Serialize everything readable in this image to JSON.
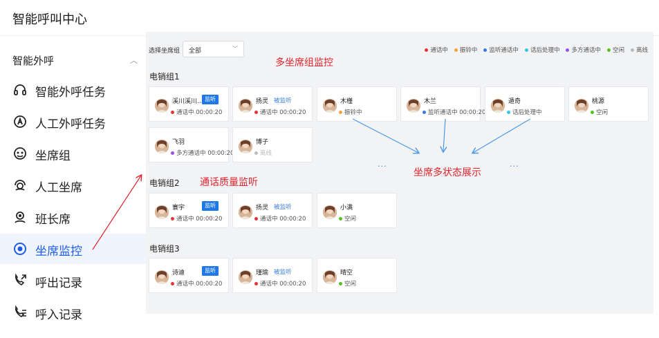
{
  "app": {
    "title": "智能呼叫中心"
  },
  "sidebar": {
    "group_label": "智能外呼",
    "items": [
      {
        "label": "智能外呼任务",
        "icon": "headset-task-icon"
      },
      {
        "label": "人工外呼任务",
        "icon": "hand-task-icon"
      },
      {
        "label": "坐席组",
        "icon": "agent-group-icon"
      },
      {
        "label": "人工坐席",
        "icon": "agent-icon"
      },
      {
        "label": "班长席",
        "icon": "supervisor-icon"
      },
      {
        "label": "坐席监控",
        "icon": "monitor-icon"
      },
      {
        "label": "呼出记录",
        "icon": "outbound-call-icon"
      },
      {
        "label": "呼入记录",
        "icon": "inbound-call-icon"
      }
    ],
    "active_index": 5
  },
  "filter": {
    "label": "选择坐席组",
    "value": "全部"
  },
  "legend": [
    {
      "label": "通话中",
      "color": "#e8333a"
    },
    {
      "label": "振铃中",
      "color": "#f2a33a"
    },
    {
      "label": "监听通话中",
      "color": "#3a78e0"
    },
    {
      "label": "话后处理中",
      "color": "#33c7e0"
    },
    {
      "label": "多方通话中",
      "color": "#9b4fdc"
    },
    {
      "label": "空闲",
      "color": "#52c41a"
    },
    {
      "label": "离线",
      "color": "#bbbbbb"
    }
  ],
  "groups": [
    {
      "title": "电销组1",
      "agents": [
        {
          "name": "溪川溪川...",
          "status": "通话中 00:00:20",
          "color": "#e8333a",
          "monitor": "监听"
        },
        {
          "name": "扬灵",
          "status": "通话中 00:00:20",
          "color": "#e8333a",
          "monitored": "被监听"
        },
        {
          "name": "木槿",
          "status": "振铃中",
          "color": "#f2a33a"
        },
        {
          "name": "木兰",
          "status": "监听通话中 00:00:20",
          "color": "#3a78e0"
        },
        {
          "name": "遁奇",
          "status": "话后处理中",
          "color": "#33c7e0"
        },
        {
          "name": "桃源",
          "status": "空闲",
          "color": "#52c41a"
        },
        {
          "name": "飞羽",
          "status": "多方通话中 00:00:20",
          "color": "#9b4fdc"
        },
        {
          "name": "博子",
          "status": "离线",
          "color": "#bbbbbb"
        }
      ]
    },
    {
      "title": "电销组2",
      "agents": [
        {
          "name": "寰宇",
          "status": "通话中 00:00:20",
          "color": "#e8333a",
          "monitor": "监听"
        },
        {
          "name": "扬灵",
          "status": "通话中 00:00:20",
          "color": "#e8333a",
          "monitored": "被监听"
        },
        {
          "name": "小满",
          "status": "空闲",
          "color": "#52c41a"
        }
      ]
    },
    {
      "title": "电销组3",
      "agents": [
        {
          "name": "诗迪",
          "status": "通话中 00:00:20",
          "color": "#e8333a",
          "monitor": "监听"
        },
        {
          "name": "瑾瑜",
          "status": "通话中 00:00:20",
          "color": "#e8333a",
          "monitored": "被监听"
        },
        {
          "name": "晴空",
          "status": "空闲",
          "color": "#52c41a"
        }
      ]
    }
  ],
  "annotations": {
    "multi_group": "多坐席组监控",
    "quality": "通话质量监听",
    "multi_status": "坐席多状态展示",
    "ellipsis": "···"
  }
}
